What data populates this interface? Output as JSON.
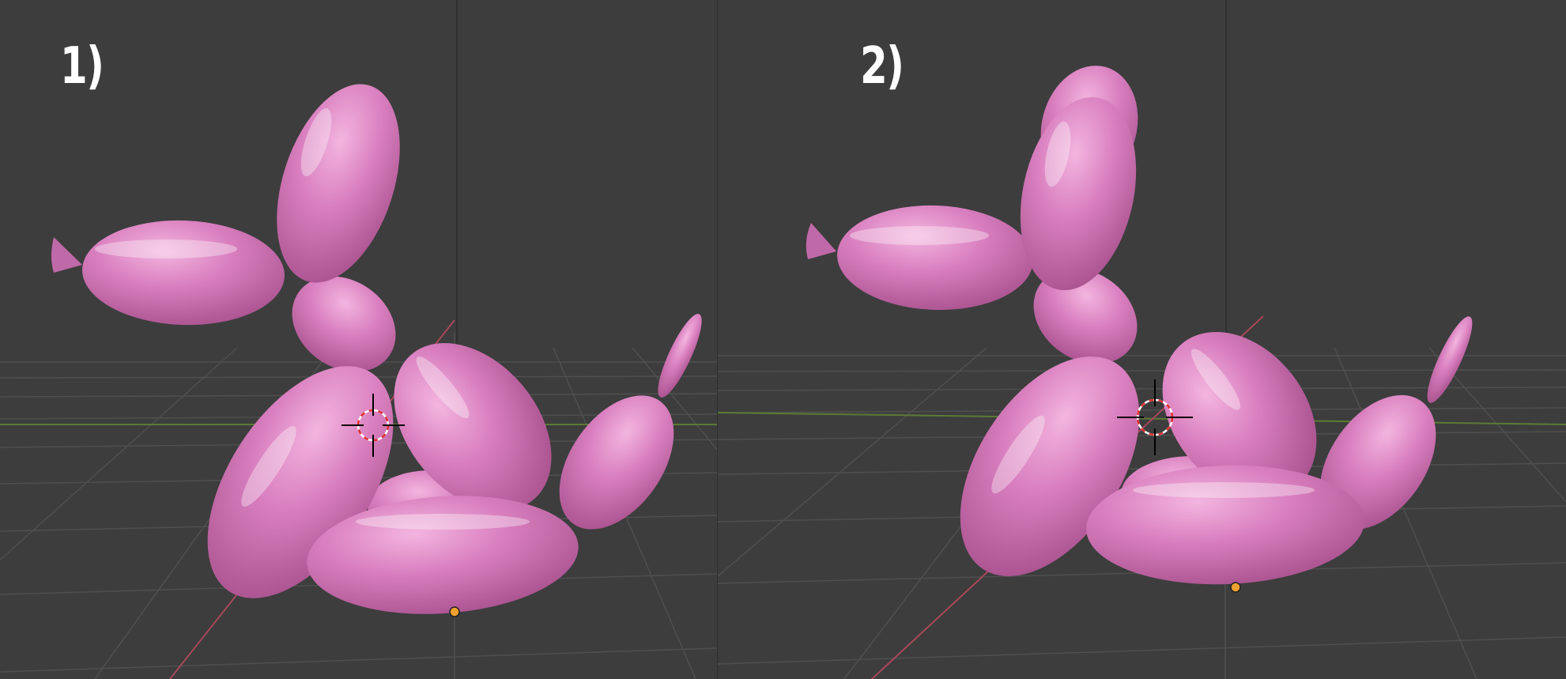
{
  "panels": [
    {
      "label": "1)"
    },
    {
      "label": "2)"
    }
  ],
  "colors": {
    "background": "#3d3d3d",
    "grid_line": "#4e4e4e",
    "x_axis": "#b04a58",
    "y_axis": "#6b8e2f",
    "balloon_base": "#d97fbf",
    "balloon_light": "#eeaad9",
    "balloon_dark": "#b2599c",
    "cursor_ring": "#e03030",
    "origin_dot": "#f0a030"
  },
  "icons": [
    "3d-cursor-icon",
    "origin-point-icon"
  ]
}
